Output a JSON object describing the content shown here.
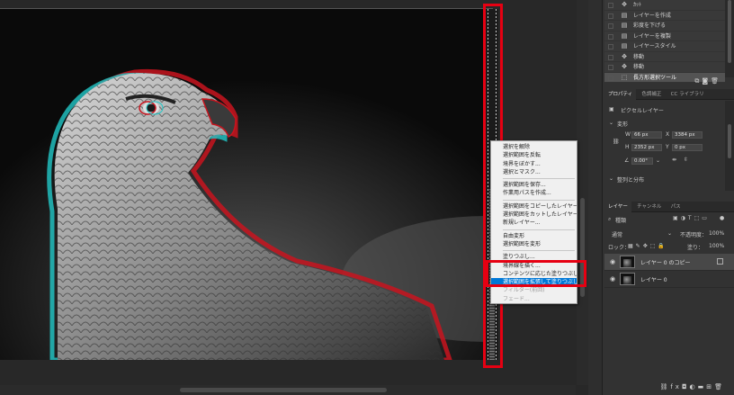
{
  "context_menu": {
    "items": [
      {
        "label": "選択を解除",
        "state": "normal"
      },
      {
        "label": "選択範囲を反転",
        "state": "normal"
      },
      {
        "label": "境界をぼかす...",
        "state": "normal"
      },
      {
        "label": "選択とマスク...",
        "state": "normal"
      },
      {
        "sep": true
      },
      {
        "label": "選択範囲を保存...",
        "state": "normal"
      },
      {
        "label": "作業用パスを作成...",
        "state": "normal"
      },
      {
        "sep": true
      },
      {
        "label": "選択範囲をコピーしたレイヤー",
        "state": "normal"
      },
      {
        "label": "選択範囲をカットしたレイヤー",
        "state": "normal"
      },
      {
        "label": "新規レイヤー...",
        "state": "normal"
      },
      {
        "sep": true
      },
      {
        "label": "自由変形",
        "state": "normal"
      },
      {
        "label": "選択範囲を変形",
        "state": "normal"
      },
      {
        "sep": true
      },
      {
        "label": "塗りつぶし...",
        "state": "normal"
      },
      {
        "label": "境界線を描く...",
        "state": "normal"
      },
      {
        "label": "コンテンツに応じた塗りつぶし...",
        "state": "normal"
      },
      {
        "label": "選択範囲を拡張して塗りつぶし",
        "state": "selected"
      },
      {
        "label": "フィルター(前回)",
        "state": "disabled"
      },
      {
        "label": "フェード...",
        "state": "disabled"
      }
    ]
  },
  "history": {
    "items": [
      {
        "label": "ｶｯﾄ",
        "icon": "move-icon"
      },
      {
        "label": "レイヤーを作成",
        "icon": "layer-icon"
      },
      {
        "label": "彩度を下げる",
        "icon": "layer-icon"
      },
      {
        "label": "レイヤーを複製",
        "icon": "layer-icon"
      },
      {
        "label": "レイヤースタイル",
        "icon": "layer-icon"
      },
      {
        "label": "移動",
        "icon": "move-icon"
      },
      {
        "label": "移動",
        "icon": "move-icon"
      },
      {
        "label": "長方形選択ツール",
        "icon": "marquee-icon",
        "active": true
      }
    ]
  },
  "properties": {
    "tabs": [
      "プロパティ",
      "色調補正",
      "CC ライブラリ"
    ],
    "layer_type": "ピクセルレイヤー",
    "transform_title": "変形",
    "w_label": "W",
    "w_value": "66 px",
    "x_label": "X",
    "x_value": "3384 px",
    "h_label": "H",
    "h_value": "2352 px",
    "y_label": "Y",
    "y_value": "0 px",
    "angle_value": "0.00°",
    "align_title": "整列と分布"
  },
  "layers": {
    "tabs": [
      "レイヤー",
      "チャンネル",
      "パス"
    ],
    "filter_kind": "種類",
    "blend_mode": "通常",
    "opacity_label": "不透明度：",
    "opacity_value": "100%",
    "lock_label": "ロック：",
    "fill_label": "塗り：",
    "fill_value": "100%",
    "items": [
      {
        "name": "レイヤー 0 のコピー",
        "selected": true
      },
      {
        "name": "レイヤー 0",
        "selected": false
      }
    ]
  },
  "colors": {
    "highlight_border": "#e60012",
    "menu_selected": "#0078d7"
  }
}
